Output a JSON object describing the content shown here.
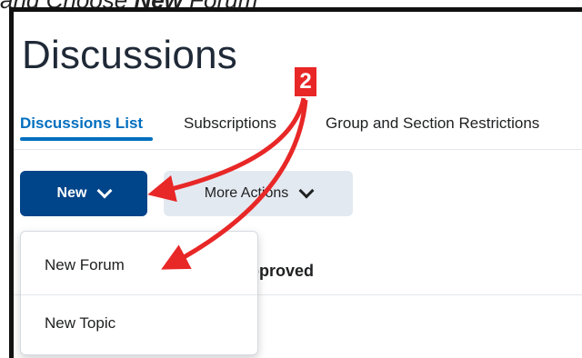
{
  "caption": {
    "text_prefix": "and Choose ",
    "text_bold": "New",
    "text_suffix": " Forum"
  },
  "page": {
    "title": "Discussions"
  },
  "tabs": [
    {
      "label": "Discussions List",
      "active": true
    },
    {
      "label": "Subscriptions",
      "active": false
    },
    {
      "label": "Group and Section Restrictions",
      "active": false
    }
  ],
  "toolbar": {
    "new_label": "New",
    "more_actions_label": "More Actions"
  },
  "background": {
    "partial_text": "pproved",
    "partial_heading": "....."
  },
  "menu": {
    "items": [
      "New Forum",
      "New Topic"
    ]
  },
  "annotation": {
    "step_number": "2",
    "color": "#e82727"
  },
  "colors": {
    "primary": "#004489",
    "accent": "#006fbf",
    "secondary_button": "#e3e9f1"
  }
}
